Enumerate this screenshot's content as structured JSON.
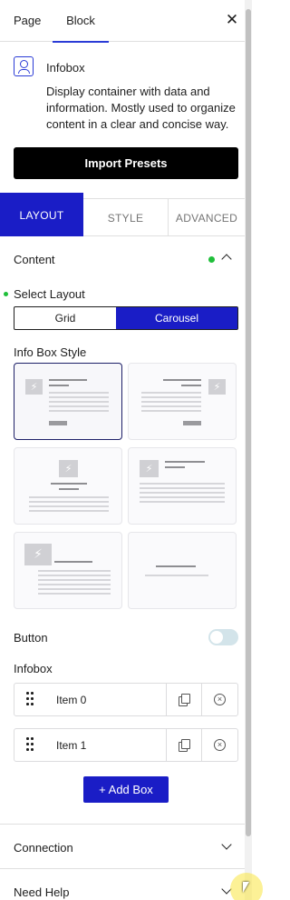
{
  "top_tabs": {
    "page": "Page",
    "block": "Block",
    "close": "✕"
  },
  "block": {
    "title": "Infobox",
    "description": "Display container with data and information. Mostly used to organize content in a clear and concise way.",
    "icon": "infobox-icon"
  },
  "import_button": "Import Presets",
  "panel_tabs": {
    "layout": "LAYOUT",
    "style": "STYLE",
    "advanced": "ADVANCED"
  },
  "content_section": {
    "title": "Content",
    "select_layout_label": "Select Layout",
    "layout_options": [
      "Grid",
      "Carousel"
    ],
    "selected_layout": "Carousel",
    "info_box_style_label": "Info Box Style",
    "style_count": 6,
    "selected_style_index": 0,
    "button_label": "Button",
    "button_enabled": false,
    "infobox_label": "Infobox",
    "items": [
      {
        "label": "Item 0"
      },
      {
        "label": "Item 1"
      }
    ],
    "add_button": "+ Add Box"
  },
  "sections": {
    "connection": "Connection",
    "need_help": "Need Help"
  },
  "colors": {
    "accent": "#1a1dc6",
    "active_tab_underline": "#2a3bd6",
    "status_dot": "#1fbf3a",
    "primary_button": "#000000"
  }
}
